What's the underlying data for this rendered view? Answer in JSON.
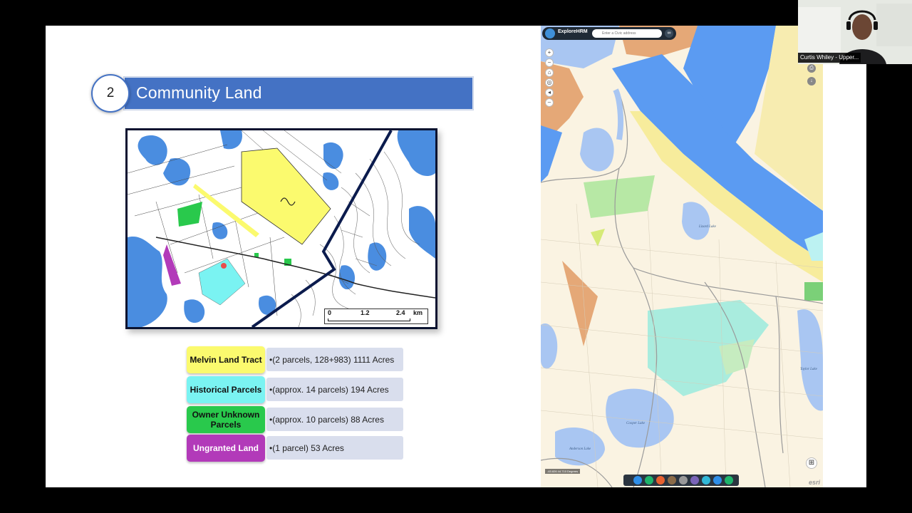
{
  "slide": {
    "section_number": "2",
    "title": "Community Land",
    "map_scale": {
      "label_0": "0",
      "label_1": "1.2",
      "label_2": "2.4",
      "unit": "km"
    },
    "legend": [
      {
        "label": "Melvin Land Tract",
        "description": "•(2 parcels, 128+983) 1111 Acres",
        "color": "#fbfa6e"
      },
      {
        "label": "Historical Parcels",
        "description": "•(approx. 14 parcels) 194 Acres",
        "color": "#7af3f2"
      },
      {
        "label": "Owner Unknown Parcels",
        "description": "•(approx. 10 parcels) 88 Acres",
        "color": "#29c94c"
      },
      {
        "label": "Ungranted Land",
        "description": "•(1 parcel) 53 Acres",
        "color": "#b23ab9"
      }
    ]
  },
  "gis": {
    "app_name": "ExploreHRM",
    "search_placeholder": "Enter a Civic address",
    "zoom_in": "+",
    "zoom_out": "−",
    "lake_labels": [
      "Lizard Lake",
      "Taylor Lake",
      "Cooper Lake",
      "Anderson Lake"
    ],
    "coordinates": "-63.826 44.710 Degrees",
    "attribution": "esri"
  },
  "webcam": {
    "participant_name": "Curtis Whiley - Upper..."
  }
}
